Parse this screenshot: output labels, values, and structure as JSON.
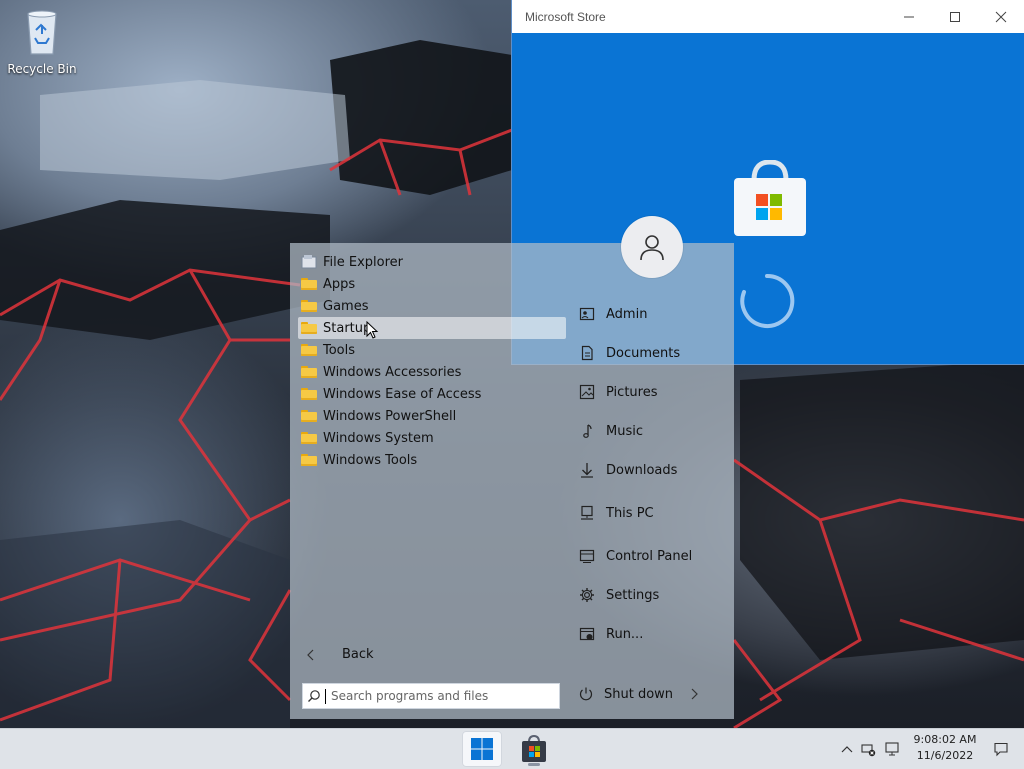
{
  "desktop": {
    "recycle_bin_label": "Recycle Bin"
  },
  "store_window": {
    "title": "Microsoft Store",
    "minimize_icon": "minimize-icon",
    "maximize_icon": "maximize-icon",
    "close_icon": "close-icon",
    "background_color": "#0a74d4"
  },
  "start_menu": {
    "programs": [
      {
        "label": "File Explorer",
        "icon": "file-explorer-icon"
      },
      {
        "label": "Apps",
        "icon": "folder-icon"
      },
      {
        "label": "Games",
        "icon": "folder-icon"
      },
      {
        "label": "Startup",
        "icon": "folder-icon"
      },
      {
        "label": "Tools",
        "icon": "folder-icon"
      },
      {
        "label": "Windows Accessories",
        "icon": "folder-icon"
      },
      {
        "label": "Windows Ease of Access",
        "icon": "folder-icon"
      },
      {
        "label": "Windows PowerShell",
        "icon": "folder-icon"
      },
      {
        "label": "Windows System",
        "icon": "folder-icon"
      },
      {
        "label": "Windows Tools",
        "icon": "folder-icon"
      }
    ],
    "hovered_program": "Startup",
    "places": [
      {
        "label": "Admin",
        "icon": "user-folder-icon"
      },
      {
        "label": "Documents",
        "icon": "document-icon"
      },
      {
        "label": "Pictures",
        "icon": "picture-icon"
      },
      {
        "label": "Music",
        "icon": "music-icon"
      },
      {
        "label": "Downloads",
        "icon": "download-icon"
      },
      {
        "label": "This PC",
        "icon": "computer-icon"
      },
      {
        "label": "Control Panel",
        "icon": "control-panel-icon"
      },
      {
        "label": "Settings",
        "icon": "gear-icon"
      },
      {
        "label": "Run...",
        "icon": "run-icon"
      }
    ],
    "back_label": "Back",
    "search_placeholder": "Search programs and files",
    "shutdown_label": "Shut down"
  },
  "taskbar": {
    "clock_time": "9:08:02 AM",
    "clock_date": "11/6/2022",
    "accent_color": "#0a74d4"
  }
}
